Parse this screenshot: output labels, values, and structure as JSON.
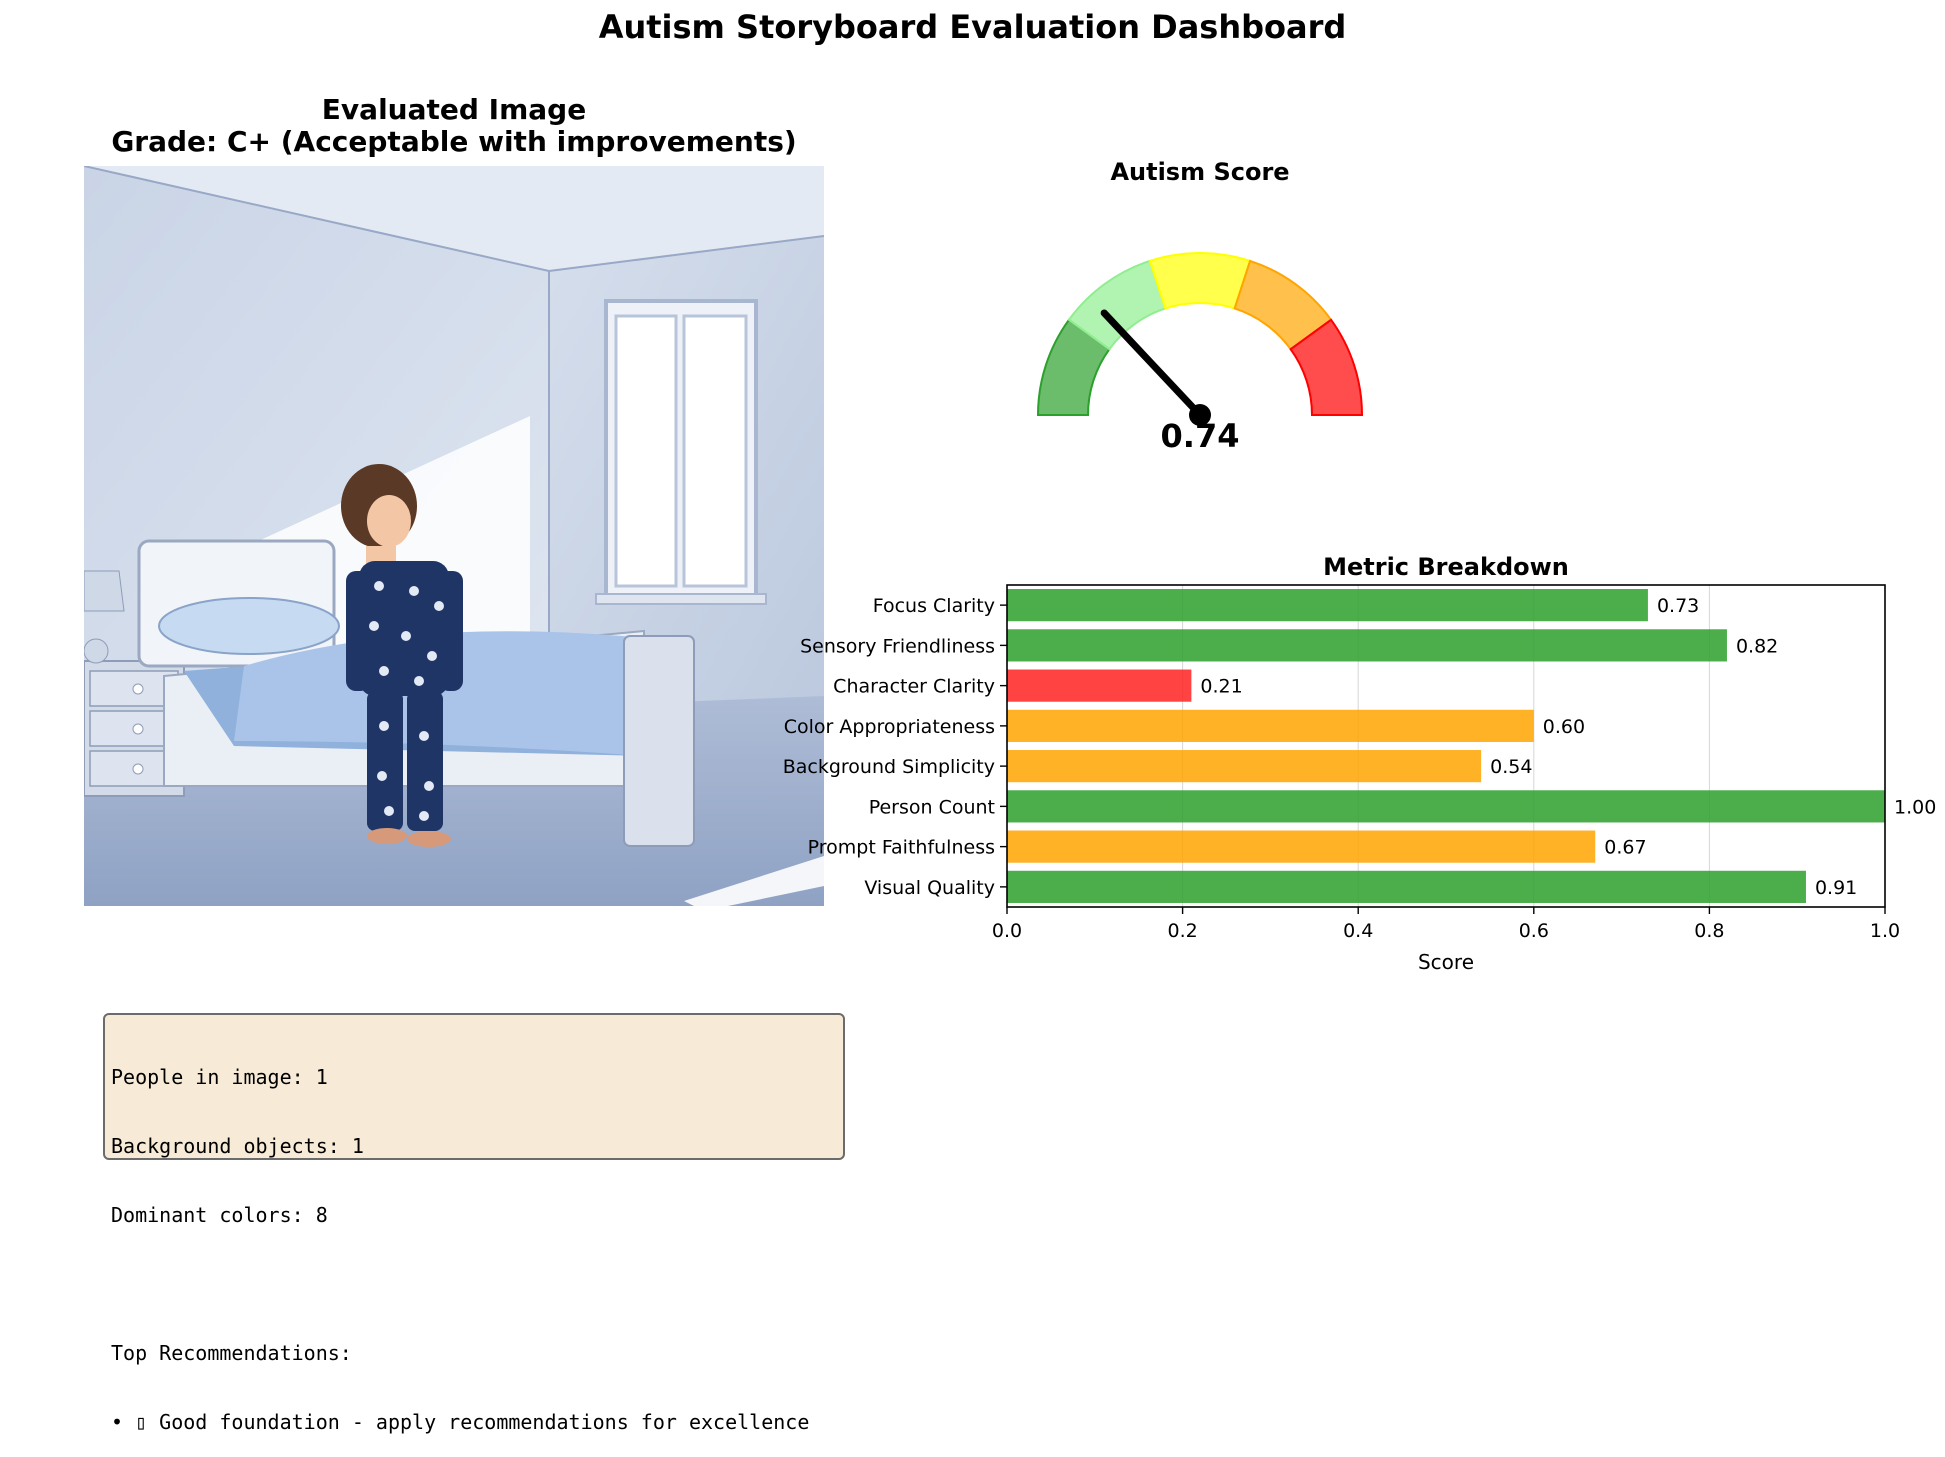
{
  "page": {
    "title": "Autism Storyboard Evaluation Dashboard"
  },
  "image_panel": {
    "title_line1": "Evaluated Image",
    "title_line2": "Grade: C+ (Acceptable with improvements)"
  },
  "info_box": {
    "lines": [
      "People in image: 1",
      "Background objects: 1",
      "Dominant colors: 8",
      "",
      "Top Recommendations:",
      "• ▯ Good foundation - apply recommendations for excellence"
    ]
  },
  "gauge": {
    "title": "Autism Score",
    "value": 0.74,
    "value_label": "0.74",
    "segment_colors": [
      "#2ca02c",
      "#90ee90",
      "#ffff00",
      "#ffa500",
      "#ff0000"
    ]
  },
  "chart_data": {
    "type": "bar",
    "orientation": "horizontal",
    "title": "Metric Breakdown",
    "xlabel": "Score",
    "ylabel": "",
    "xlim": [
      0,
      1.0
    ],
    "xticks": [
      "0.0",
      "0.2",
      "0.4",
      "0.6",
      "0.8",
      "1.0"
    ],
    "grid": true,
    "categories": [
      "Focus Clarity",
      "Sensory Friendliness",
      "Character Clarity",
      "Color Appropriateness",
      "Background Simplicity",
      "Person Count",
      "Prompt Faithfulness",
      "Visual Quality"
    ],
    "values": [
      0.73,
      0.82,
      0.21,
      0.6,
      0.54,
      1.0,
      0.67,
      0.91
    ],
    "value_labels": [
      "0.73",
      "0.82",
      "0.21",
      "0.60",
      "0.54",
      "1.00",
      "0.67",
      "0.91"
    ],
    "bar_colors": [
      "#2ca02c",
      "#2ca02c",
      "#ff2222",
      "#ffa500",
      "#ffa500",
      "#2ca02c",
      "#ffa500",
      "#2ca02c"
    ]
  }
}
